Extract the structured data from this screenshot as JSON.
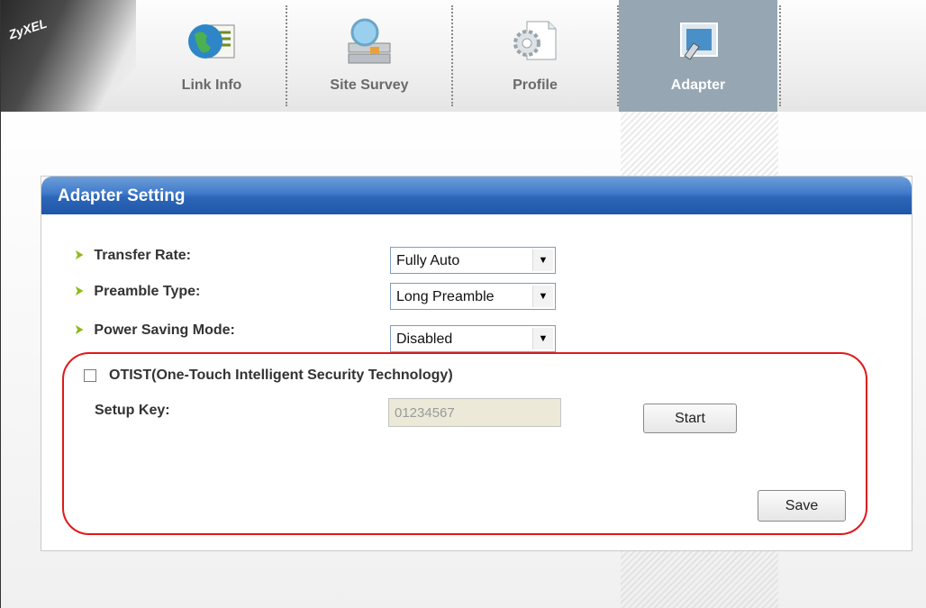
{
  "brand": {
    "logo_text": "ZyXEL"
  },
  "tabs": [
    {
      "label": "Link Info",
      "icon": "globe-document-icon",
      "active": false
    },
    {
      "label": "Site Survey",
      "icon": "network-magnifier-icon",
      "active": false
    },
    {
      "label": "Profile",
      "icon": "gear-document-icon",
      "active": false
    },
    {
      "label": "Adapter",
      "icon": "adapter-card-icon",
      "active": true
    }
  ],
  "panel": {
    "title": "Adapter Setting",
    "fields": [
      {
        "label": "Transfer Rate:",
        "value": "Fully Auto"
      },
      {
        "label": "Preamble Type:",
        "value": "Long Preamble"
      },
      {
        "label": "Power Saving Mode:",
        "value": "Disabled"
      }
    ],
    "otist": {
      "label": "OTIST(One-Touch Intelligent Security Technology)",
      "checked": false,
      "setup_key_label": "Setup Key:",
      "setup_key_value": "01234567",
      "start_label": "Start"
    },
    "save_label": "Save"
  },
  "colors": {
    "header_blue": "#2d66b8",
    "active_tab": "#96a7b3",
    "highlight_outline": "#e11818",
    "bullet_green": "#8dbb1a"
  }
}
